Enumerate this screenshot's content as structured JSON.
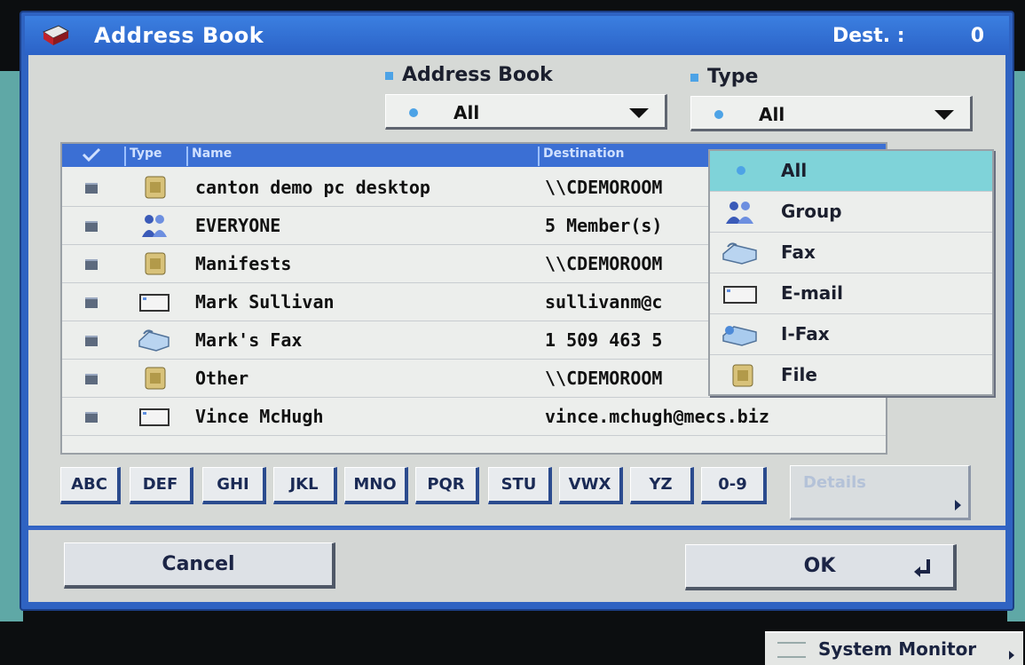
{
  "window": {
    "title": "Address Book",
    "dest_label": "Dest. :",
    "dest_count": "0"
  },
  "filters": {
    "address_book": {
      "label": "Address Book",
      "value": "All"
    },
    "type": {
      "label": "Type",
      "value": "All"
    }
  },
  "list": {
    "columns": [
      "",
      "Type",
      "Name",
      "Destination"
    ],
    "rows": [
      {
        "type_icon": "file-folder-icon",
        "name": "canton demo pc desktop",
        "destination": "\\\\CDEMOROOM"
      },
      {
        "type_icon": "group-icon",
        "name": "EVERYONE",
        "destination": "5 Member(s)"
      },
      {
        "type_icon": "file-folder-icon",
        "name": "Manifests",
        "destination": "\\\\CDEMOROOM"
      },
      {
        "type_icon": "email-icon",
        "name": "Mark Sullivan",
        "destination": "sullivanm@c"
      },
      {
        "type_icon": "fax-icon",
        "name": "Mark's Fax",
        "destination": "1 509 463 5"
      },
      {
        "type_icon": "file-folder-icon",
        "name": "Other",
        "destination": "\\\\CDEMOROOM"
      },
      {
        "type_icon": "email-icon",
        "name": "Vince McHugh",
        "destination": "vince.mchugh@mecs.biz"
      }
    ]
  },
  "type_dropdown": {
    "selected": "All",
    "options": [
      {
        "label": "All",
        "icon": "dot-icon"
      },
      {
        "label": "Group",
        "icon": "group-icon"
      },
      {
        "label": "Fax",
        "icon": "fax-icon"
      },
      {
        "label": "E-mail",
        "icon": "email-icon"
      },
      {
        "label": "I-Fax",
        "icon": "ifax-icon"
      },
      {
        "label": "File",
        "icon": "file-folder-icon"
      }
    ]
  },
  "alpha_buttons": [
    "ABC",
    "DEF",
    "GHI",
    "JKL",
    "MNO",
    "PQR",
    "STU",
    "VWX",
    "YZ",
    "0-9"
  ],
  "details_button": "Details",
  "footer": {
    "cancel": "Cancel",
    "ok": "OK"
  },
  "system_monitor": "System Monitor",
  "colors": {
    "title_bar": "#2b62c7",
    "panel": "#d6d9d6",
    "selected_option": "#7fd3d9",
    "header": "#3b6fd4"
  }
}
